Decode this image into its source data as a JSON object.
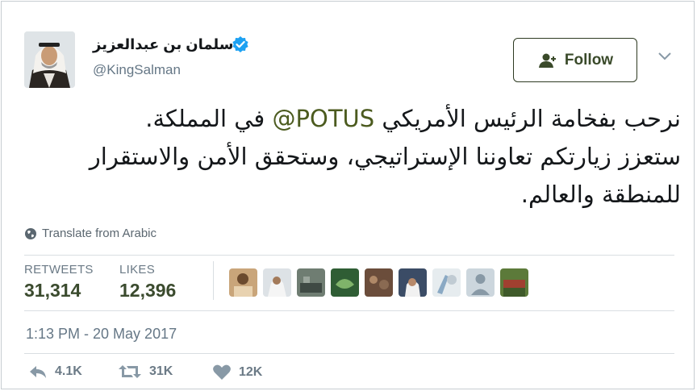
{
  "user": {
    "display_name": "سلمان بن عبدالعزيز",
    "handle": "@KingSalman",
    "verified": true
  },
  "follow_button": {
    "label": "Follow"
  },
  "tweet": {
    "line1_prefix": "نرحب بفخامة الرئيس الأمريكي",
    "mention": "@POTUS",
    "line1_suffix": "في المملكة.",
    "line2": "ستعزز زيارتكم تعاوننا الإستراتيجي، وستحقق الأمن والاستقرار",
    "line3": "للمنطقة والعالم."
  },
  "translate": {
    "label": "Translate from Arabic"
  },
  "stats": {
    "retweets_label": "RETWEETS",
    "retweets_value": "31,314",
    "likes_label": "LIKES",
    "likes_value": "12,396"
  },
  "timestamp": "1:13 PM - 20 May 2017",
  "actions": {
    "reply_count": "4.1K",
    "retweet_count": "31K",
    "like_count": "12K"
  },
  "colors": {
    "accent": "#4c5b1f",
    "verified": "#1da1f2",
    "secondary_text": "#657786"
  }
}
